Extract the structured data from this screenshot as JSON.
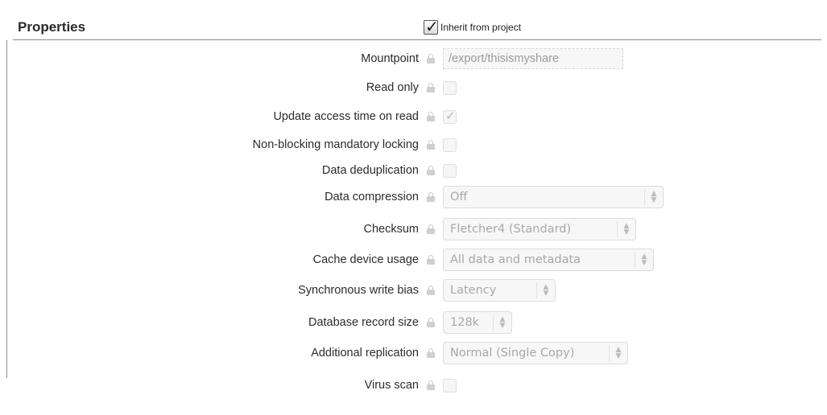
{
  "header": {
    "title": "Properties",
    "inherit_label": "Inherit from project",
    "inherit_checked": true
  },
  "fields": {
    "mountpoint": {
      "label": "Mountpoint",
      "value": "/export/thisismyshare"
    },
    "read_only": {
      "label": "Read only",
      "checked": false
    },
    "update_access_time": {
      "label": "Update access time on read",
      "checked": true
    },
    "nbmand": {
      "label": "Non-blocking mandatory locking",
      "checked": false
    },
    "dedup": {
      "label": "Data deduplication",
      "checked": false
    },
    "compression": {
      "label": "Data compression",
      "value": "Off"
    },
    "checksum": {
      "label": "Checksum",
      "value": "Fletcher4 (Standard)"
    },
    "cache_device": {
      "label": "Cache device usage",
      "value": "All data and metadata"
    },
    "sync_bias": {
      "label": "Synchronous write bias",
      "value": "Latency"
    },
    "record_size": {
      "label": "Database record size",
      "value": "128k"
    },
    "replication": {
      "label": "Additional replication",
      "value": "Normal (Single Copy)"
    },
    "virus_scan": {
      "label": "Virus scan",
      "checked": false
    }
  },
  "icons": {
    "lock": "lock-icon",
    "check": "checkmark-icon",
    "spinner": "up-down-arrows-icon"
  },
  "colors": {
    "disabled_text": "#a8a8a8",
    "rule": "#8a8a8a"
  }
}
